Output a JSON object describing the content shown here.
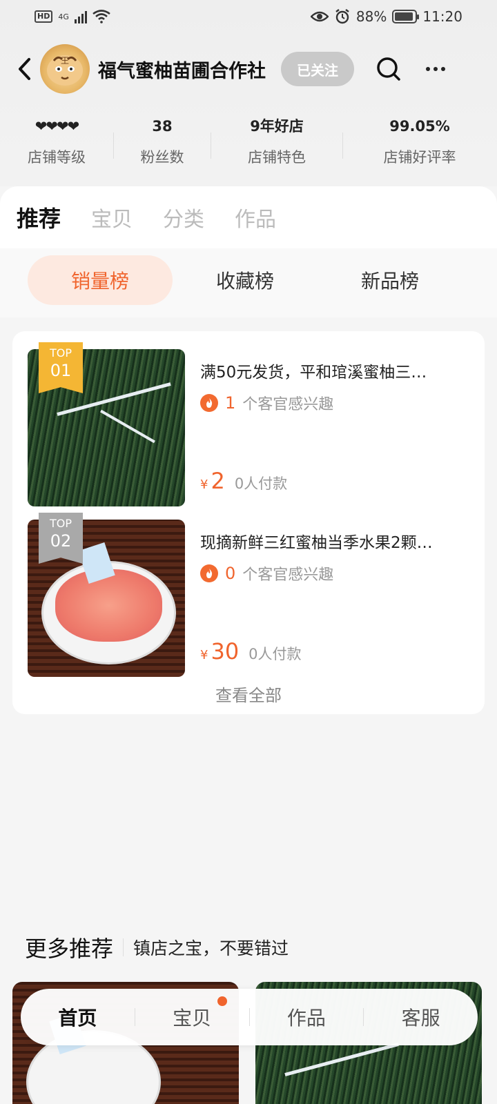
{
  "status_bar": {
    "hd": "HD",
    "network": "4G",
    "battery": "88%",
    "time": "11:20"
  },
  "header": {
    "shop_name": "福气蜜柚苗圃合作社",
    "follow_label": "已关注",
    "avatar_text": "王"
  },
  "stats": [
    {
      "value": "❤❤❤❤",
      "label": "店铺等级"
    },
    {
      "value": "38",
      "label": "粉丝数"
    },
    {
      "value": "9年好店",
      "label": "店铺特色"
    },
    {
      "value": "99.05%",
      "label": "店铺好评率"
    }
  ],
  "tabs": [
    "推荐",
    "宝贝",
    "分类",
    "作品"
  ],
  "rank_tabs": [
    "销量榜",
    "收藏榜",
    "新品榜"
  ],
  "items": [
    {
      "badge_top": "TOP",
      "badge_num": "01",
      "title": "满50元发货，平和琯溪蜜柚三…",
      "interest_num": "1",
      "interest_text": "个客官感兴趣",
      "currency": "¥",
      "price": "2",
      "paid": "0人付款"
    },
    {
      "badge_top": "TOP",
      "badge_num": "02",
      "title": "现摘新鲜三红蜜柚当季水果2颗…",
      "interest_num": "0",
      "interest_text": "个客官感兴趣",
      "currency": "¥",
      "price": "30",
      "paid": "0人付款"
    }
  ],
  "view_all": "查看全部",
  "more_recommend": {
    "title": "更多推荐",
    "subtitle": "镇店之宝，不要错过"
  },
  "bottom_nav": [
    "首页",
    "宝贝",
    "作品",
    "客服"
  ],
  "colors": {
    "accent": "#f0642d",
    "gold_badge": "#f4b634",
    "gray_badge": "#a9a9a9",
    "follow_bg": "#c9c9c9"
  }
}
